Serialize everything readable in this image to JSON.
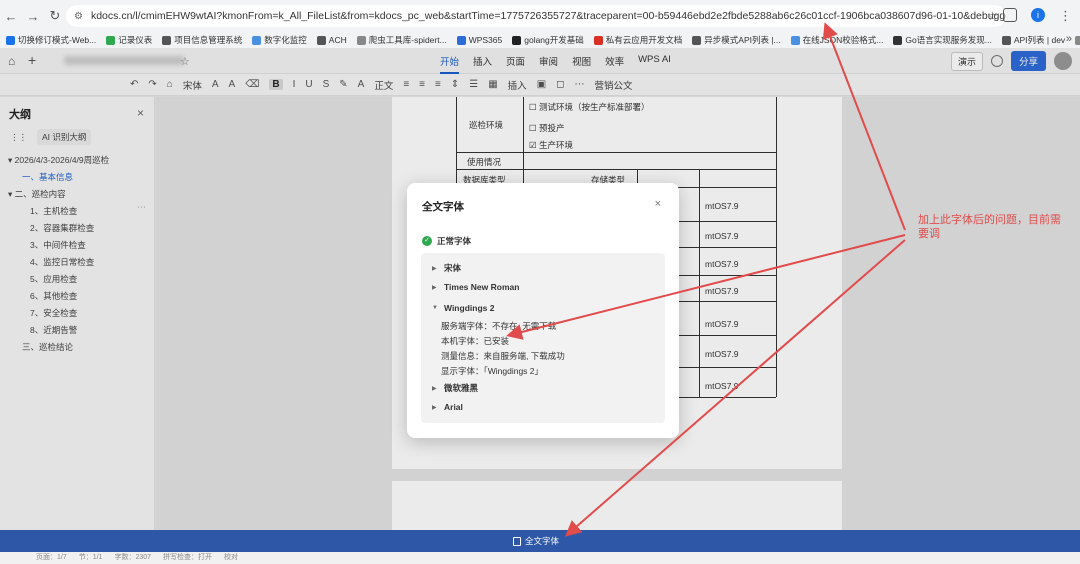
{
  "browser": {
    "url": "kdocs.cn/l/cmimEHW9wtAI?kmonFrom=k_All_FileList&from=kdocs_pc_web&startTime=1775726355727&traceparent=00-b59446ebd2e2fbde5288ab6c26c01ccf-1906bca038607d96-01-10&debugger",
    "profile_letter": "i",
    "bookmarks": [
      {
        "label": "切换修订模式-Web...",
        "color": "#1a73e8"
      },
      {
        "label": "记录仪表",
        "color": "#2fa84f"
      },
      {
        "label": "项目信息管理系统",
        "color": "#555555"
      },
      {
        "label": "数字化监控",
        "color": "#4a90e2"
      },
      {
        "label": "ACH",
        "color": "#555555"
      },
      {
        "label": "爬虫工具库-spidert...",
        "color": "#888888"
      },
      {
        "label": "WPS365",
        "color": "#2f6bd9"
      },
      {
        "label": "golang开发基础",
        "color": "#222222"
      },
      {
        "label": "私有云应用开发文档",
        "color": "#d93025"
      },
      {
        "label": "异步模式API列表 |...",
        "color": "#555555"
      },
      {
        "label": "在线JSON校验格式...",
        "color": "#4a90e2"
      },
      {
        "label": "Go语言实现服务发现...",
        "color": "#333333"
      },
      {
        "label": "API列表 | dev",
        "color": "#555555"
      },
      {
        "label": "DEV开放平台",
        "color": "#888888"
      }
    ]
  },
  "wps": {
    "title_blurred": "",
    "tabs": [
      "开始",
      "插入",
      "页面",
      "审阅",
      "视图",
      "效率",
      "WPS AI"
    ],
    "active_tab": "开始",
    "presentation_label": "演示",
    "share_label": "分享",
    "toolbar": {
      "font_name": "宋体",
      "bold": "B",
      "italic": "I",
      "underline": "U",
      "style": "正文",
      "insert": "插入",
      "official_doc": "营销公文"
    }
  },
  "sidebar": {
    "title": "大纲",
    "ai_label": "AI 识别大纲",
    "items": [
      {
        "label": "2026/4/3-2026/4/9周巡检",
        "level": 0,
        "caret": "▾"
      },
      {
        "label": "一、基本信息",
        "level": 1,
        "caret": "",
        "selected": true
      },
      {
        "label": "二、巡检内容",
        "level": 0,
        "caret": "▾"
      },
      {
        "label": "1、主机检查",
        "level": 2,
        "caret": ""
      },
      {
        "label": "2、容器集群检查",
        "level": 2,
        "caret": ""
      },
      {
        "label": "3、中间件检查",
        "level": 2,
        "caret": ""
      },
      {
        "label": "4、监控日常检查",
        "level": 2,
        "caret": ""
      },
      {
        "label": "5、应用检查",
        "level": 2,
        "caret": ""
      },
      {
        "label": "6、其他检查",
        "level": 2,
        "caret": ""
      },
      {
        "label": "7、安全检查",
        "level": 2,
        "caret": ""
      },
      {
        "label": "8、近期告警",
        "level": 2,
        "caret": ""
      },
      {
        "label": "三、巡检结论",
        "level": 1,
        "caret": ""
      }
    ]
  },
  "document": {
    "env_label": "巡检环境",
    "options": [
      "☐ 测试环境（按生产标准部署）",
      "☐ 预投产",
      "☑ 生产环境"
    ],
    "usage_label": "使用情况",
    "db_type_label": "数据库类型",
    "storage_type_label": "存储类型",
    "cells": [
      "mtOS7.9",
      "mtOS7.9",
      "mtOS7.9",
      "mtOS7.9",
      "mtOS7.9",
      "mtOS7.9",
      "mtOS7.9"
    ]
  },
  "modal": {
    "title": "全文字体",
    "section": "正常字体",
    "fonts": [
      {
        "name": "宋体",
        "expanded": false
      },
      {
        "name": "Times New Roman",
        "expanded": false
      },
      {
        "name": "Wingdings 2",
        "expanded": true
      },
      {
        "name": "微软雅黑",
        "expanded": false
      },
      {
        "name": "Arial",
        "expanded": false
      }
    ],
    "details": [
      "服务端字体：不存在, 无需下载",
      "本机字体：已安装",
      "测量信息：来自服务端, 下载成功",
      "显示字体：「Wingdings 2」"
    ]
  },
  "bottom": {
    "label": "全文字体",
    "status": [
      "页面：1/7",
      "节：1/1",
      "字数：2307",
      "拼写检查：打开",
      "校对"
    ]
  },
  "annotation": {
    "text": "加上此字体后的问题，目前需要调",
    "color": "#e24b4b"
  }
}
